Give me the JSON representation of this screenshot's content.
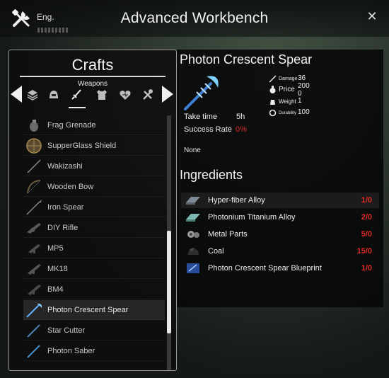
{
  "header": {
    "window_title": "Advanced Workbench",
    "eng_label": "Eng.",
    "close_glyph": "✕"
  },
  "crafts_panel": {
    "title": "Crafts",
    "category": "Weapons",
    "category_icons": [
      "armor-icon",
      "helmet-icon",
      "sword-icon",
      "vest-icon",
      "heart-icon",
      "tools-icon"
    ],
    "items": [
      {
        "label": "Frag Grenade",
        "icon": "grenade-icon"
      },
      {
        "label": "SupperGlass Shield",
        "icon": "shield-icon"
      },
      {
        "label": "Wakizashi",
        "icon": "blade-icon"
      },
      {
        "label": "Wooden Bow",
        "icon": "bow-icon"
      },
      {
        "label": "Iron Spear",
        "icon": "spear-icon"
      },
      {
        "label": "DIY Rifle",
        "icon": "rifle-icon"
      },
      {
        "label": "MP5",
        "icon": "smg-icon"
      },
      {
        "label": "MK18",
        "icon": "rifle-icon"
      },
      {
        "label": "BM4",
        "icon": "rifle-icon"
      },
      {
        "label": "Photon Crescent Spear",
        "icon": "photon-spear-icon",
        "selected": true
      },
      {
        "label": "Star Cutter",
        "icon": "blade-icon"
      },
      {
        "label": "Photon Saber",
        "icon": "saber-icon"
      }
    ]
  },
  "detail": {
    "title": "Photon Crescent Spear",
    "stats": {
      "damage_label": "Damage",
      "damage_value": "36",
      "price_label": "Price",
      "price_value_1": "200",
      "price_value_2": "0",
      "weight_label": "Weight",
      "weight_value": "1",
      "durability_label": "Durability",
      "durability_value": "100"
    },
    "take_time_label": "Take time",
    "take_time_value": "5h",
    "success_rate_label": "Success Rate",
    "success_rate_value": "0%",
    "requirement": "None",
    "ingredients_title": "Ingredients",
    "ingredients": [
      {
        "name": "Hyper-fiber Alloy",
        "count": "1/0",
        "icon": "alloy-icon"
      },
      {
        "name": "Photonium Titanium Alloy",
        "count": "2/0",
        "icon": "titanium-alloy-icon"
      },
      {
        "name": "Metal Parts",
        "count": "5/0",
        "icon": "metal-parts-icon"
      },
      {
        "name": "Coal",
        "count": "15/0",
        "icon": "coal-icon"
      },
      {
        "name": "Photon Crescent Spear Blueprint",
        "count": "1/0",
        "icon": "blueprint-icon"
      }
    ]
  },
  "colors": {
    "accent_red": "#e02a2a",
    "photon_blue": "#4fa3ff"
  }
}
